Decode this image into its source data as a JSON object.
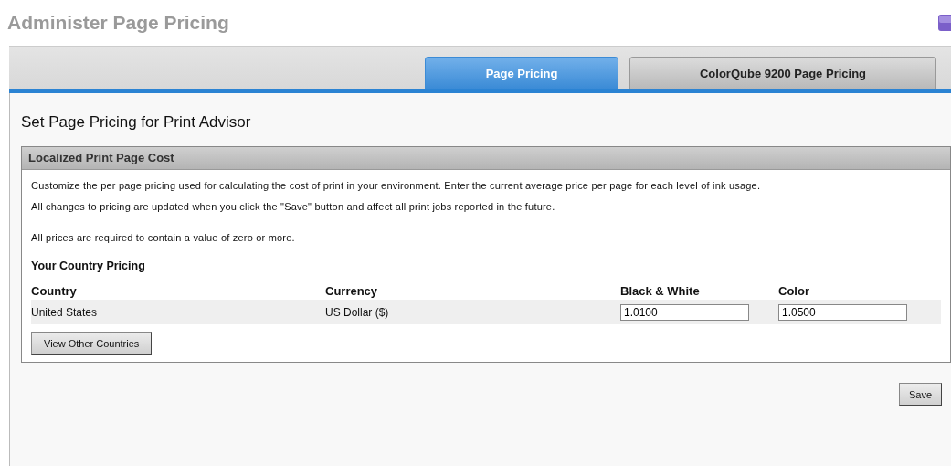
{
  "page_title": "Administer Page Pricing",
  "tabs": [
    {
      "label": "Page Pricing",
      "selected": true
    },
    {
      "label": "ColorQube 9200 Page Pricing",
      "selected": false
    }
  ],
  "heading": "Set Page Pricing for Print Advisor",
  "panel": {
    "title": "Localized Print Page Cost",
    "paragraphs": [
      "Customize the per page pricing used for calculating the cost of print in your environment. Enter the current average price per page for each level of ink usage.",
      "All changes to pricing are updated when you click the \"Save\" button and affect all print jobs reported in the future.",
      "All prices are required to contain a value of zero or more."
    ],
    "section_title": "Your Country Pricing",
    "table": {
      "columns": [
        "Country",
        "Currency",
        "Black & White",
        "Color"
      ],
      "rows": [
        {
          "country": "United States",
          "currency": "US Dollar ($)",
          "black_white": "1.0100",
          "color_price": "1.0500"
        }
      ]
    },
    "button": "View Other Countries"
  },
  "save_button": "Save"
}
